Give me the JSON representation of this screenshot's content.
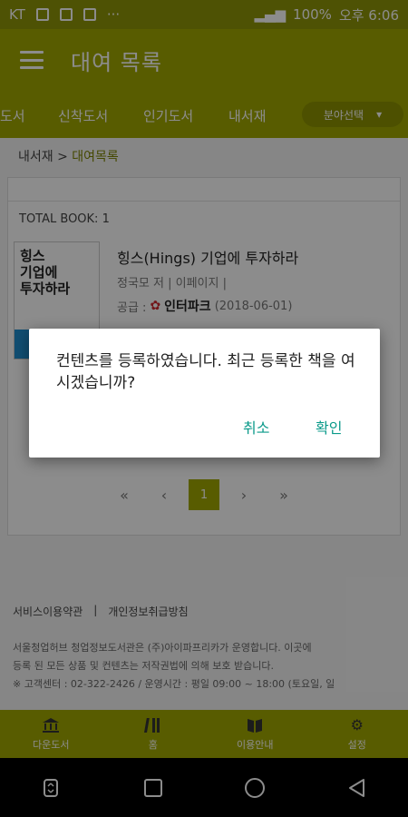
{
  "status_bar": {
    "carrier": "KT",
    "battery": "100%",
    "time": "오후 6:06"
  },
  "app_bar": {
    "title": "대여 목록",
    "menu_icon": "menu-icon"
  },
  "tabs": {
    "items": [
      {
        "label": "도서"
      },
      {
        "label": "신착도서"
      },
      {
        "label": "인기도서"
      },
      {
        "label": "내서재"
      }
    ],
    "select_label": "분야선택"
  },
  "breadcrumb": {
    "parent": "내서재",
    "separator": " > ",
    "current": "대여목록"
  },
  "list": {
    "total_label": "TOTAL BOOK: 1",
    "book": {
      "cover_text": "힝스\n기업에\n투자하라",
      "title": "힝스(Hings) 기업에 투자하라",
      "meta": "정국모 저 | 이페이지 |",
      "supply_label": "공급 :",
      "vendor": "인터파크",
      "date": "(2018-06-01)"
    }
  },
  "pager": {
    "first": "«",
    "prev": "‹",
    "current": "1",
    "next": "›",
    "last": "»"
  },
  "footer": {
    "terms": "서비스이용약관",
    "sep": "|",
    "privacy": "개인정보취급방침",
    "line1": "서울청업허브 청업정보도서관은 (주)아이파프리카가 운영합니다. 이곳에",
    "line2": "등록 된 모든 상품 및 컨텐츠는 저작권법에 의해 보호 받습니다.",
    "line3": "※ 고객센터 : 02-322-2426 / 운영시간 : 평일 09:00 ~ 18:00 (토요일, 일"
  },
  "bottom_nav": [
    {
      "label": "다운도서",
      "icon": "bank-icon"
    },
    {
      "label": "홈",
      "icon": "books-icon"
    },
    {
      "label": "이용안내",
      "icon": "book-icon"
    },
    {
      "label": "설정",
      "icon": "gear-icon"
    }
  ],
  "dialog": {
    "message": "컨텐츠를 등록하였습니다. 최근 등록한 책을 여시겠습니까?",
    "cancel_label": "취소",
    "confirm_label": "확인"
  },
  "colors": {
    "accent": "#a0a800",
    "statusbar": "#8f9608",
    "dialog_button": "#0b9a8a"
  }
}
